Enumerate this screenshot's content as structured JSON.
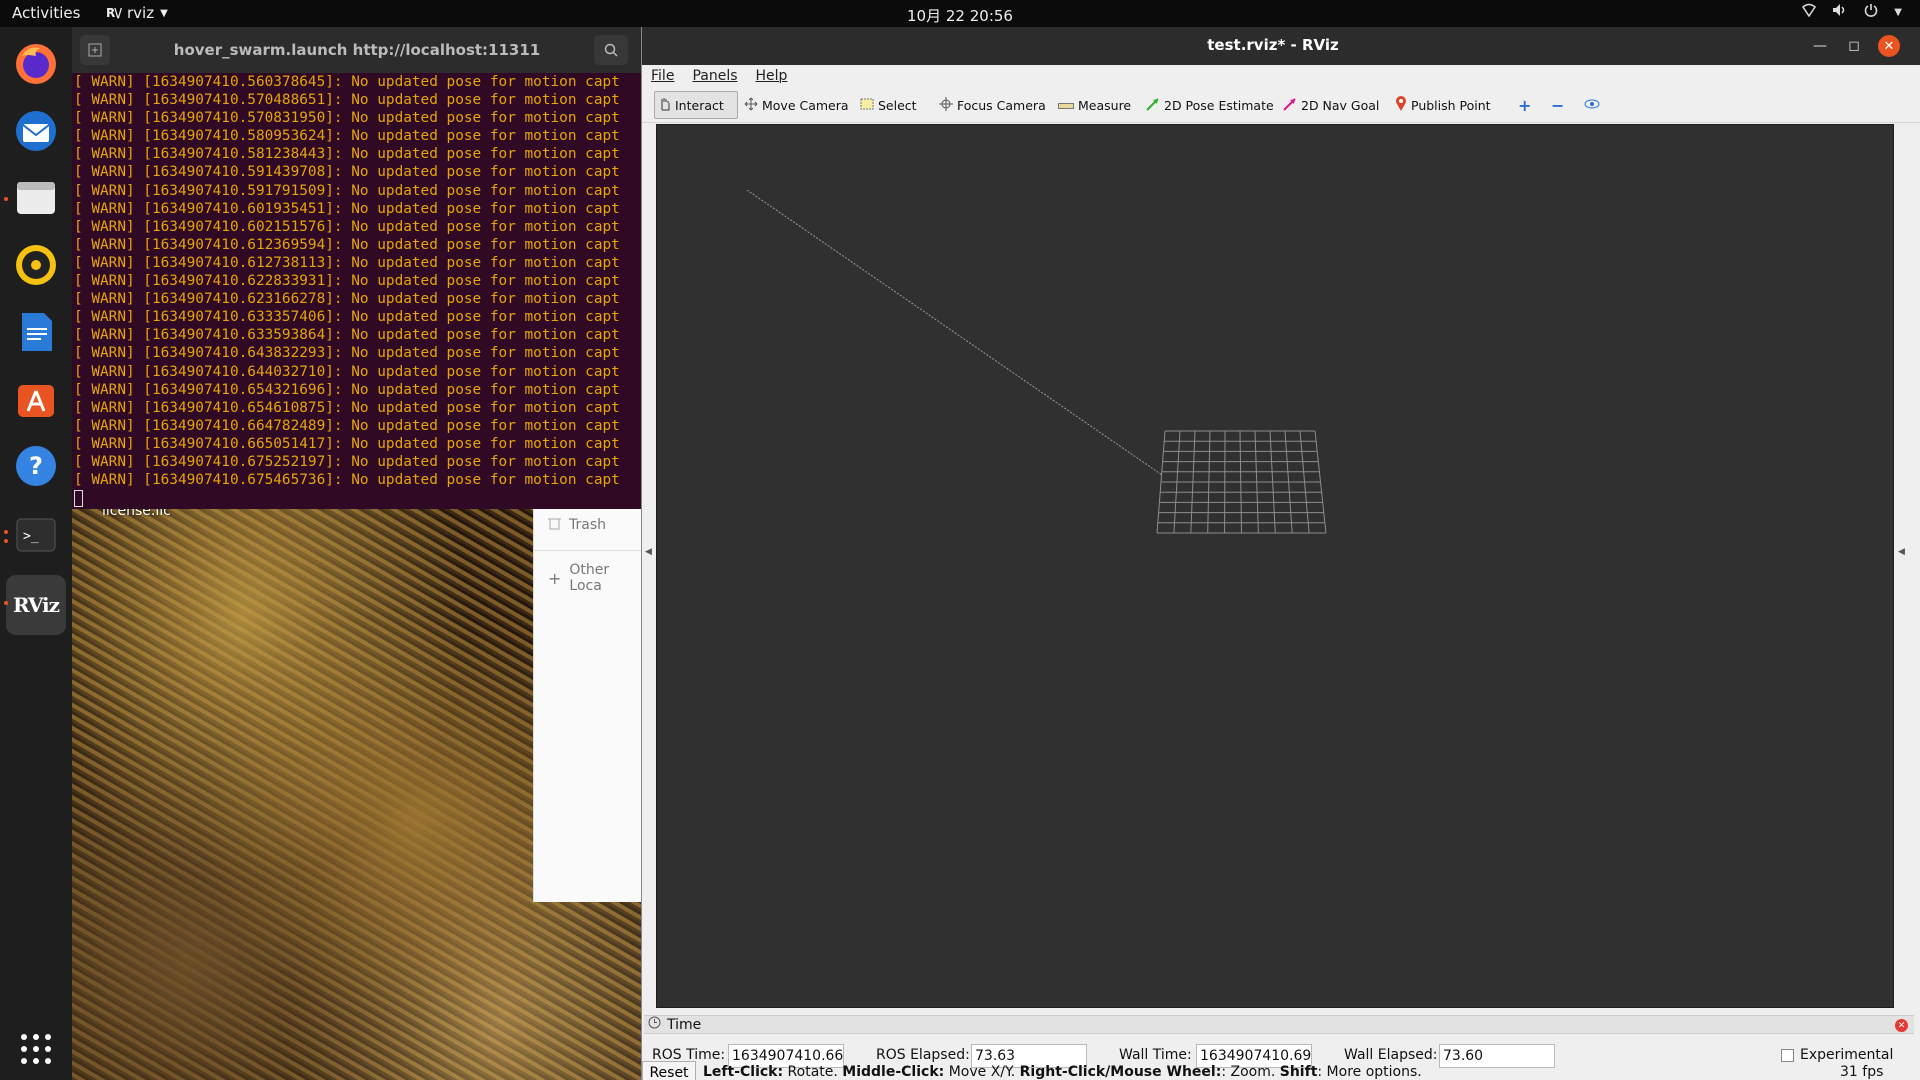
{
  "topbar": {
    "activities": "Activities",
    "app_name": "rviz",
    "clock": "10月 22  20:56"
  },
  "dock": {
    "items": [
      "firefox-icon",
      "thunderbird-icon",
      "files-icon",
      "rhythmbox-icon",
      "writer-icon",
      "software-icon",
      "help-icon",
      "terminal-icon",
      "rviz-icon",
      "show-apps-icon"
    ]
  },
  "desktop": {
    "file_label": "license.lic"
  },
  "file_manager": {
    "trash_label": "Trash",
    "other_label": "Other Loca"
  },
  "terminal": {
    "title": "hover_swarm.launch http://localhost:11311",
    "lines": [
      "[ WARN] [1634907410.560378645]: No updated pose for motion capt",
      "[ WARN] [1634907410.570488651]: No updated pose for motion capt",
      "[ WARN] [1634907410.570831950]: No updated pose for motion capt",
      "[ WARN] [1634907410.580953624]: No updated pose for motion capt",
      "[ WARN] [1634907410.581238443]: No updated pose for motion capt",
      "[ WARN] [1634907410.591439708]: No updated pose for motion capt",
      "[ WARN] [1634907410.591791509]: No updated pose for motion capt",
      "[ WARN] [1634907410.601935451]: No updated pose for motion capt",
      "[ WARN] [1634907410.602151576]: No updated pose for motion capt",
      "[ WARN] [1634907410.612369594]: No updated pose for motion capt",
      "[ WARN] [1634907410.612738113]: No updated pose for motion capt",
      "[ WARN] [1634907410.622833931]: No updated pose for motion capt",
      "[ WARN] [1634907410.623166278]: No updated pose for motion capt",
      "[ WARN] [1634907410.633357406]: No updated pose for motion capt",
      "[ WARN] [1634907410.633593864]: No updated pose for motion capt",
      "[ WARN] [1634907410.643832293]: No updated pose for motion capt",
      "[ WARN] [1634907410.644032710]: No updated pose for motion capt",
      "[ WARN] [1634907410.654321696]: No updated pose for motion capt",
      "[ WARN] [1634907410.654610875]: No updated pose for motion capt",
      "[ WARN] [1634907410.664782489]: No updated pose for motion capt",
      "[ WARN] [1634907410.665051417]: No updated pose for motion capt",
      "[ WARN] [1634907410.675252197]: No updated pose for motion capt",
      "[ WARN] [1634907410.675465736]: No updated pose for motion capt"
    ]
  },
  "rviz": {
    "title": "test.rviz* - RViz",
    "menu": {
      "file": "File",
      "panels": "Panels",
      "help": "Help"
    },
    "tools": {
      "interact": "Interact",
      "move_camera": "Move Camera",
      "select": "Select",
      "focus_camera": "Focus Camera",
      "measure": "Measure",
      "pose_estimate": "2D Pose Estimate",
      "nav_goal": "2D Nav Goal",
      "publish_point": "Publish Point"
    },
    "time_panel": {
      "title": "Time",
      "ros_time_label": "ROS Time:",
      "ros_time": "1634907410.66",
      "ros_elapsed_label": "ROS Elapsed:",
      "ros_elapsed": "73.63",
      "wall_time_label": "Wall Time:",
      "wall_time": "1634907410.69",
      "wall_elapsed_label": "Wall Elapsed:",
      "wall_elapsed": "73.60",
      "experimental": "Experimental"
    },
    "status": {
      "reset": "Reset",
      "left_click": "Left-Click:",
      "left_click_desc": " Rotate. ",
      "middle_click": "Middle-Click:",
      "middle_click_desc": " Move X/Y. ",
      "right_click": "Right-Click/Mouse Wheel:",
      "right_click_desc": ": Zoom. ",
      "shift": "Shift",
      "shift_desc": ": More options.",
      "fps": "31 fps"
    }
  },
  "colors": {
    "terminal_bg": "#300a24",
    "warn_text": "#e5a50a",
    "ubuntu_orange": "#e95420",
    "viewport_bg": "#303030"
  }
}
